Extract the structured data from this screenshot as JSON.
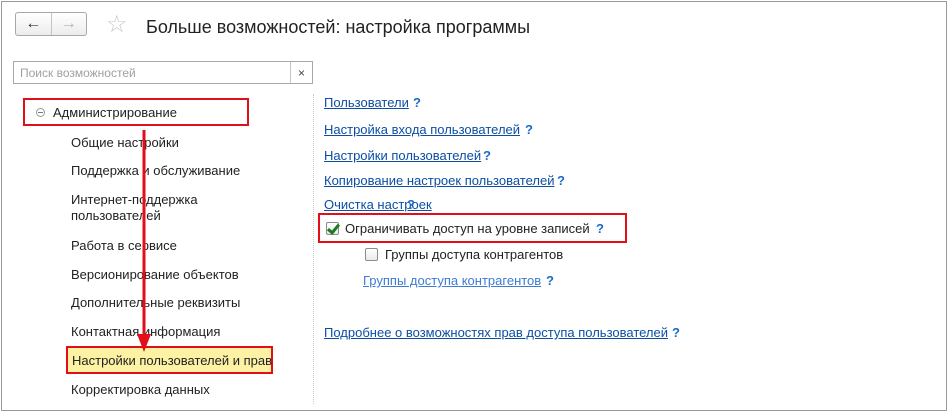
{
  "header": {
    "back_icon": "←",
    "forward_icon": "→",
    "star_icon": "☆",
    "title": "Больше возможностей: настройка программы"
  },
  "search": {
    "placeholder": "Поиск возможностей",
    "value": "",
    "clear_icon": "×"
  },
  "sidebar": {
    "section": "Администрирование",
    "items": [
      "Общие настройки",
      "Поддержка и обслуживание",
      "Интернет-поддержка",
      "пользователей",
      "Работа в сервисе",
      "Версионирование объектов",
      "Дополнительные реквизиты",
      "Контактная информация",
      "Настройки пользователей и прав",
      "Корректировка данных"
    ]
  },
  "main": {
    "links": [
      "Пользователи",
      "Настройка входа пользователей",
      "Настройки пользователей",
      "Копирование настроек пользователей",
      "Очистка настроек"
    ],
    "restrict_access_label": "Ограничивать доступ на уровне записей",
    "restrict_access_checked": true,
    "contractor_groups_label": "Группы доступа контрагентов",
    "contractor_groups_checked": false,
    "contractor_groups_link": "Группы доступа контрагентов",
    "more_link": "Подробнее о возможностях прав доступа пользователей",
    "help_symbol": "?"
  },
  "colors": {
    "highlight_border": "#e30e1a",
    "active_item_bg": "#fdf1a4",
    "link": "#0b4ea2"
  }
}
